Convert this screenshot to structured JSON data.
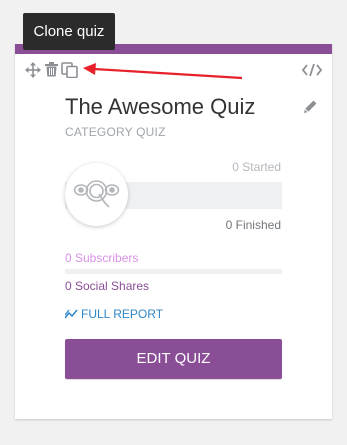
{
  "tooltip": {
    "text": "Clone quiz"
  },
  "toolbar": {
    "move_icon": "move-arrows-icon",
    "trash_icon": "trash-icon",
    "clone_icon": "clone-icon",
    "embed_icon": "code-icon",
    "edit_icon": "pencil-icon"
  },
  "quiz": {
    "title": "The Awesome Quiz",
    "category": "CATEGORY QUIZ",
    "logo_icon": "quiz-logo-icon"
  },
  "stats": {
    "started": "0 Started",
    "finished": "0 Finished",
    "subscribers": "0 Subscribers",
    "social_shares": "0 Social Shares",
    "subscribers_progress": 0
  },
  "actions": {
    "full_report": "FULL REPORT",
    "edit_quiz": "EDIT QUIZ"
  },
  "colors": {
    "accent": "#8a4e97",
    "link": "#2e87c5",
    "subscribers": "#d891e6",
    "annotation_arrow": "#e8202a",
    "tooltip_bg": "#2b2b2b"
  }
}
